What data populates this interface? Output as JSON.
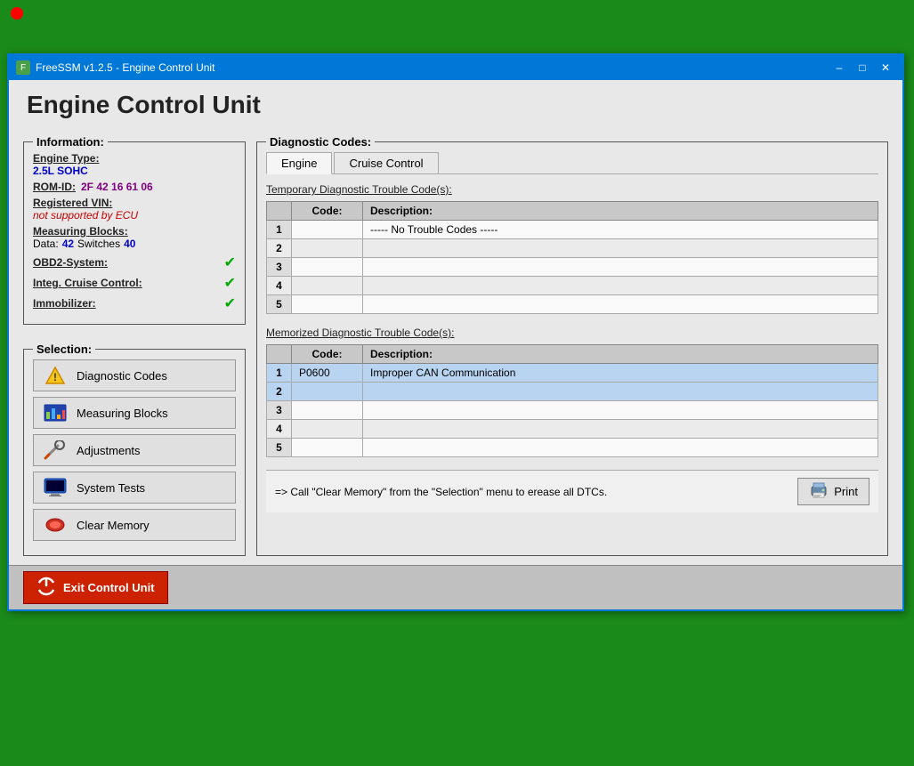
{
  "window": {
    "title": "FreeSSM v1.2.5 - Engine Control Unit",
    "page_title": "Engine Control Unit"
  },
  "titlebar": {
    "minimize": "–",
    "maximize": "□",
    "close": "✕"
  },
  "information": {
    "legend": "Information:",
    "engine_type_label": "Engine Type:",
    "engine_type_value": "2.5L SOHC",
    "rom_id_label": "ROM-ID:",
    "rom_id_value": "2F 42 16 61 06",
    "registered_vin_label": "Registered VIN:",
    "registered_vin_value": "not supported by ECU",
    "measuring_blocks_label": "Measuring Blocks:",
    "measuring_data_label": "Data:",
    "measuring_data_value": "42",
    "measuring_switches_label": "Switches",
    "measuring_switches_value": "40",
    "obd2_label": "OBD2-System:",
    "cruise_label": "Integ. Cruise Control:",
    "immobilizer_label": "Immobilizer:"
  },
  "selection": {
    "legend": "Selection:",
    "buttons": [
      {
        "id": "diagnostic-codes",
        "label": "Diagnostic Codes",
        "icon": "warning"
      },
      {
        "id": "measuring-blocks",
        "label": "Measuring Blocks",
        "icon": "chart"
      },
      {
        "id": "adjustments",
        "label": "Adjustments",
        "icon": "wrench"
      },
      {
        "id": "system-tests",
        "label": "System Tests",
        "icon": "monitor"
      },
      {
        "id": "clear-memory",
        "label": "Clear Memory",
        "icon": "eraser"
      }
    ]
  },
  "diagnostic": {
    "legend": "Diagnostic Codes:",
    "tabs": [
      "Engine",
      "Cruise Control"
    ],
    "active_tab": "Engine",
    "temporary_label": "Temporary Diagnostic Trouble Code(s):",
    "memorized_label": "Memorized Diagnostic Trouble Code(s):",
    "col_code": "Code:",
    "col_description": "Description:",
    "temporary_rows": [
      {
        "num": "1",
        "code": "",
        "description": "----- No Trouble Codes -----"
      },
      {
        "num": "2",
        "code": "",
        "description": ""
      },
      {
        "num": "3",
        "code": "",
        "description": ""
      },
      {
        "num": "4",
        "code": "",
        "description": ""
      },
      {
        "num": "5",
        "code": "",
        "description": ""
      }
    ],
    "memorized_rows": [
      {
        "num": "1",
        "code": "P0600",
        "description": "Improper CAN Communication",
        "highlight": true
      },
      {
        "num": "2",
        "code": "",
        "description": "",
        "highlight": true
      },
      {
        "num": "3",
        "code": "",
        "description": ""
      },
      {
        "num": "4",
        "code": "",
        "description": ""
      },
      {
        "num": "5",
        "code": "",
        "description": ""
      }
    ],
    "status_message": "=> Call \"Clear Memory\" from the \"Selection\" menu to erease all DTCs.",
    "print_label": "Print"
  },
  "exit": {
    "label": "Exit Control Unit"
  }
}
